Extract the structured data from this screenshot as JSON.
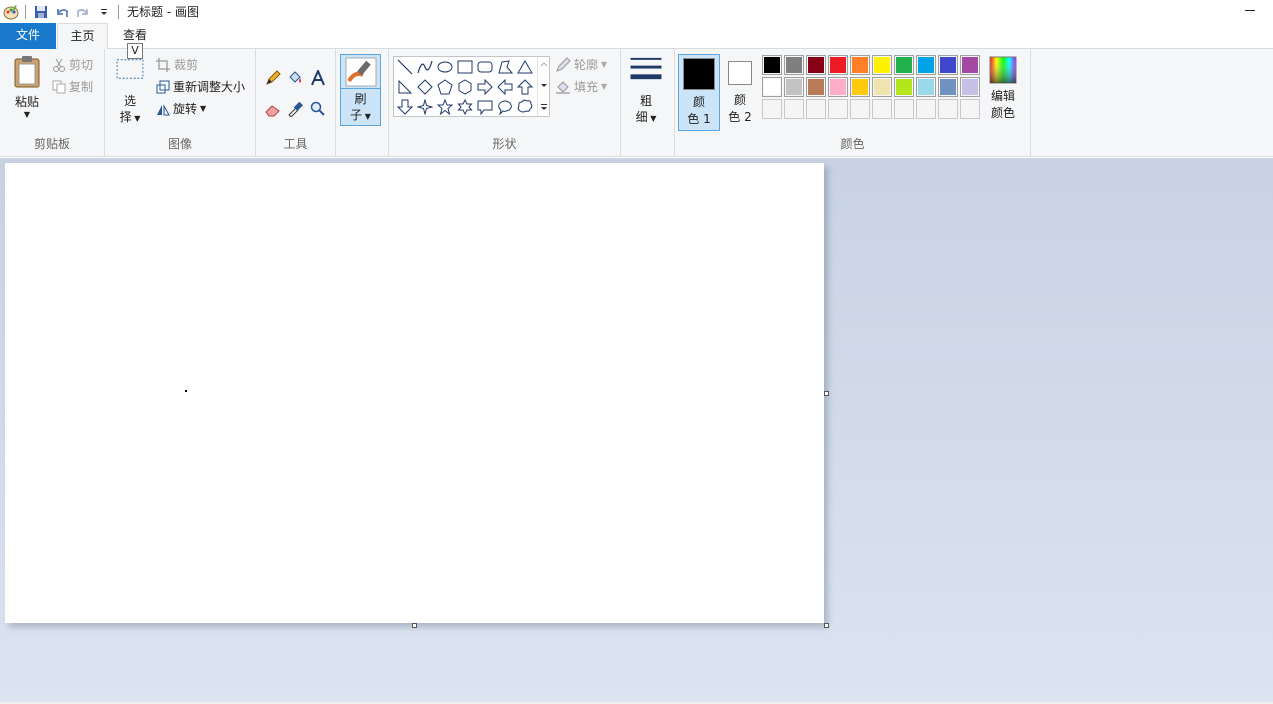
{
  "titlebar": {
    "title": "无标题 - 画图"
  },
  "tabs": {
    "file": "文件",
    "home": "主页",
    "view": "查看",
    "keytip": "V"
  },
  "clipboard": {
    "paste": "粘贴",
    "cut": "剪切",
    "copy": "复制",
    "label": "剪贴板"
  },
  "image": {
    "select_1": "选",
    "select_2": "择",
    "crop": "裁剪",
    "resize": "重新调整大小",
    "rotate": "旋转",
    "label": "图像"
  },
  "tools": {
    "label": "工具"
  },
  "brushes": {
    "line1": "刷",
    "line2": "子"
  },
  "shapes": {
    "outline": "轮廓",
    "fill": "填充",
    "label": "形状"
  },
  "size": {
    "line1": "粗",
    "line2": "细"
  },
  "colors": {
    "color1_line1": "颜",
    "color1_line2": "色 1",
    "color2_line1": "颜",
    "color2_line2": "色 2",
    "edit_line1": "编辑",
    "edit_line2": "颜色",
    "label": "颜色",
    "color1_value": "#000000",
    "color2_value": "#ffffff",
    "palette_row1": [
      "#000000",
      "#7f7f7f",
      "#880015",
      "#ed1c24",
      "#ff7f27",
      "#fff200",
      "#22b14c",
      "#00a2e8",
      "#3f48cc",
      "#a349a4"
    ],
    "palette_row2": [
      "#ffffff",
      "#c3c3c3",
      "#b97a57",
      "#ffaec9",
      "#ffc90e",
      "#efe4b0",
      "#b5e61d",
      "#99d9ea",
      "#7092be",
      "#c8bfe7"
    ],
    "palette_row3": [
      "#f5f5f5",
      "#f5f5f5",
      "#f5f5f5",
      "#f5f5f5",
      "#f5f5f5",
      "#f5f5f5",
      "#f5f5f5",
      "#f5f5f5",
      "#f5f5f5",
      "#f5f5f5"
    ]
  },
  "accent": "#1979ca"
}
